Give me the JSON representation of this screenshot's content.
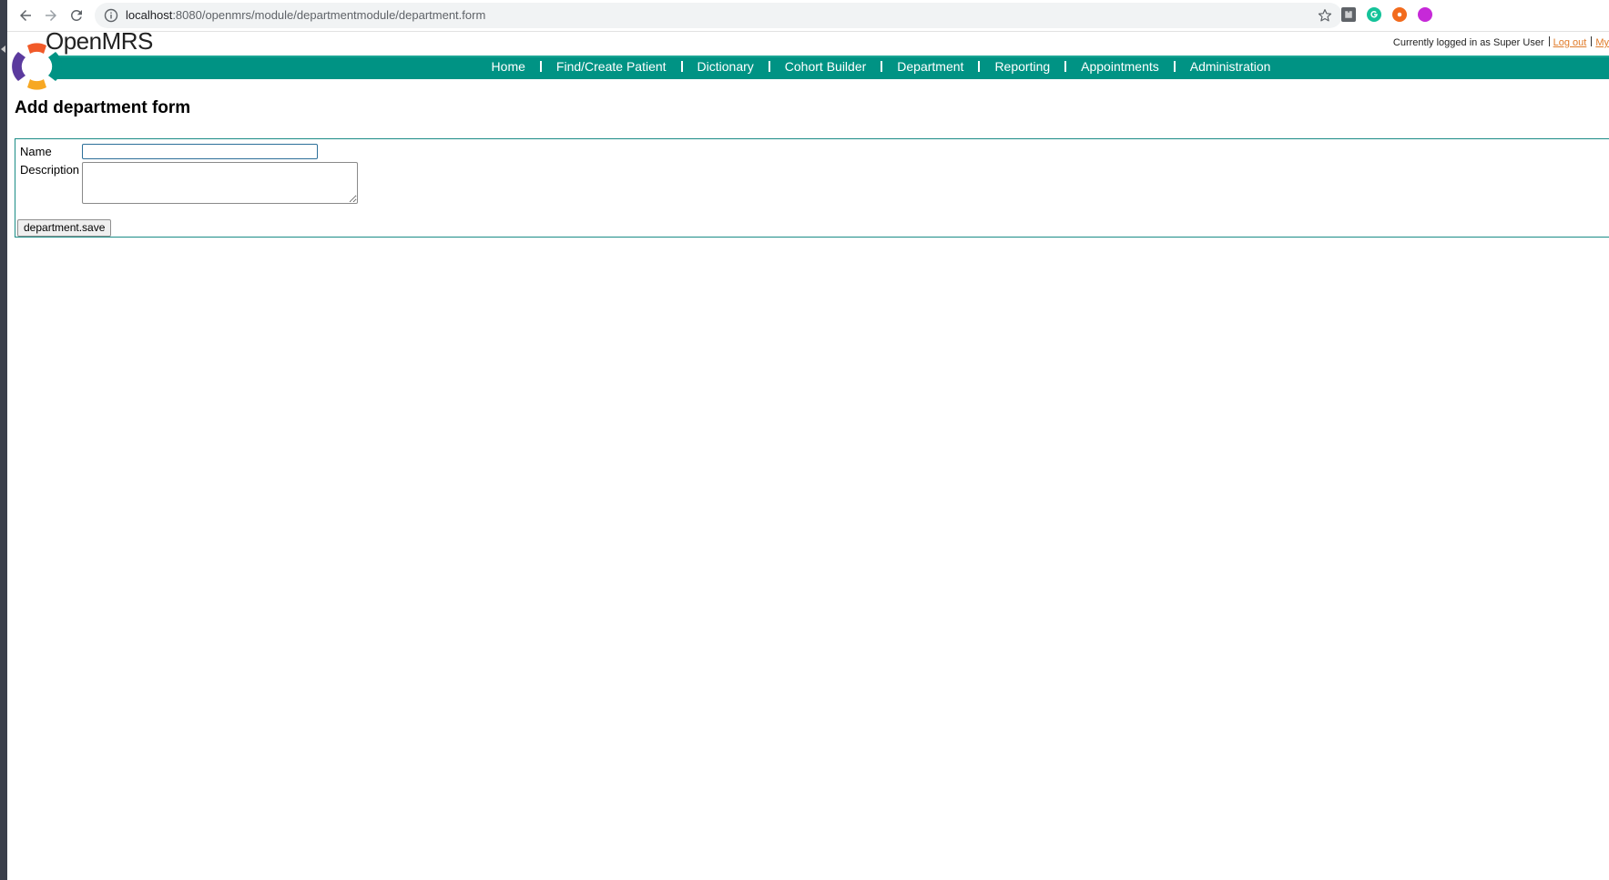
{
  "browser": {
    "url_host": "localhost",
    "url_rest": ":8080/openmrs/module/departmentmodule/department.form"
  },
  "header": {
    "app_name": "OpenMRS",
    "logged_in_text": "Currently logged in as Super User",
    "logout_label": "Log out",
    "my_profile_label": "My"
  },
  "menu": {
    "items": [
      {
        "label": "Home"
      },
      {
        "label": "Find/Create Patient"
      },
      {
        "label": "Dictionary"
      },
      {
        "label": "Cohort Builder"
      },
      {
        "label": "Department"
      },
      {
        "label": "Reporting"
      },
      {
        "label": "Appointments"
      },
      {
        "label": "Administration"
      }
    ]
  },
  "page": {
    "title": "Add department form"
  },
  "form": {
    "name_label": "Name",
    "name_value": "",
    "description_label": "Description",
    "description_value": "",
    "save_label": "department.save"
  },
  "colors": {
    "menu_bar": "#009384",
    "link": "#e07b29",
    "form_border": "#1a8c86"
  }
}
